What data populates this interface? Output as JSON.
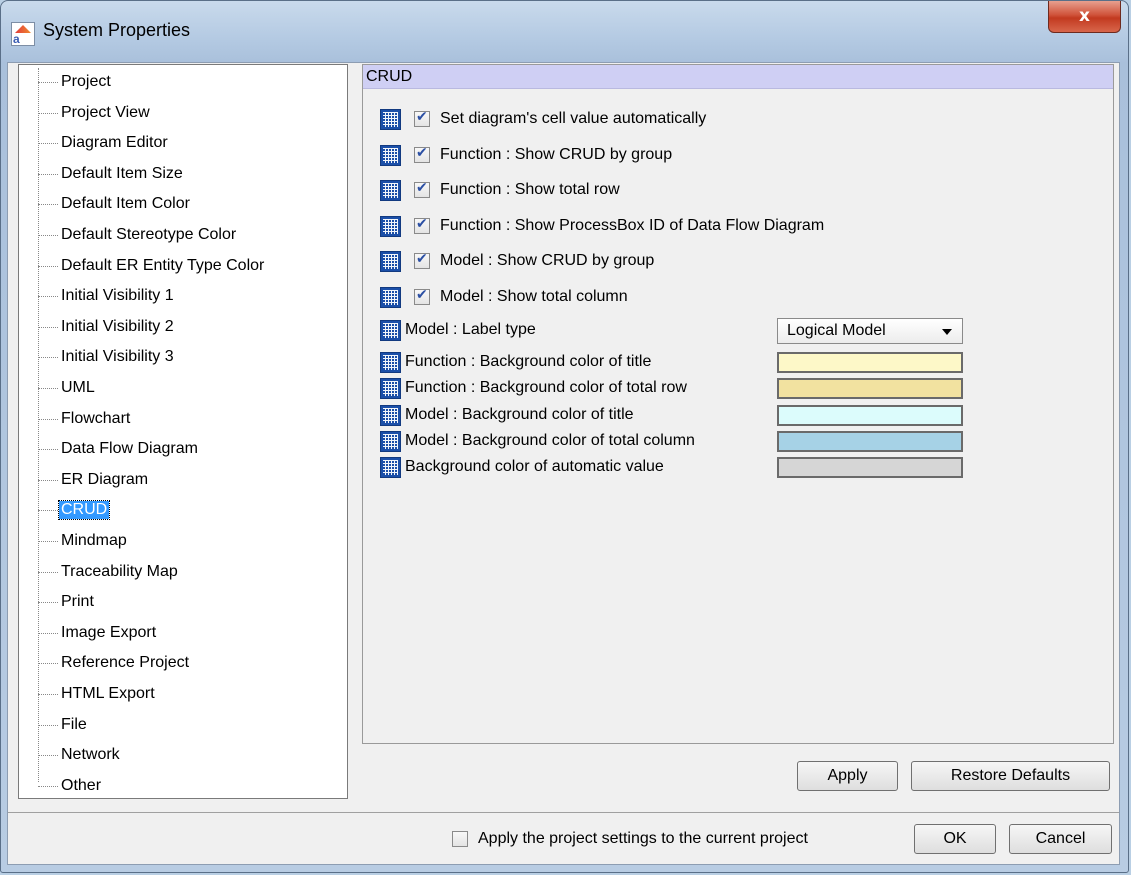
{
  "window": {
    "title": "System Properties",
    "close_glyph": "x"
  },
  "app_icon": {
    "text": "a"
  },
  "tree": {
    "items": [
      {
        "label": "Project"
      },
      {
        "label": "Project View"
      },
      {
        "label": "Diagram Editor"
      },
      {
        "label": "Default Item Size"
      },
      {
        "label": "Default Item Color"
      },
      {
        "label": "Default Stereotype Color"
      },
      {
        "label": "Default ER Entity Type Color"
      },
      {
        "label": "Initial Visibility 1"
      },
      {
        "label": "Initial Visibility 2"
      },
      {
        "label": "Initial Visibility 3"
      },
      {
        "label": "UML"
      },
      {
        "label": "Flowchart"
      },
      {
        "label": "Data Flow Diagram"
      },
      {
        "label": "ER Diagram"
      },
      {
        "label": "CRUD",
        "selected": true
      },
      {
        "label": "Mindmap"
      },
      {
        "label": "Traceability Map"
      },
      {
        "label": "Print"
      },
      {
        "label": "Image Export"
      },
      {
        "label": "Reference Project"
      },
      {
        "label": "HTML Export"
      },
      {
        "label": "File"
      },
      {
        "label": "Network"
      },
      {
        "label": "Other"
      }
    ]
  },
  "panel": {
    "header": "CRUD",
    "checkbox_options": [
      {
        "label": "Set diagram's cell value automatically",
        "checked": true
      },
      {
        "label": "Function : Show CRUD by group",
        "checked": true
      },
      {
        "label": "Function : Show total row",
        "checked": true
      },
      {
        "label": "Function : Show ProcessBox ID of Data Flow Diagram",
        "checked": true
      },
      {
        "label": "Model : Show CRUD by group",
        "checked": true
      },
      {
        "label": "Model : Show total column",
        "checked": true
      }
    ],
    "label_type": {
      "label": "Model : Label type",
      "value": "Logical Model"
    },
    "color_options": [
      {
        "label": "Function : Background color of title",
        "color": "#fdf8c8"
      },
      {
        "label": "Function : Background color of total row",
        "color": "#f2e2a0"
      },
      {
        "label": "Model : Background color of title",
        "color": "#dcfcfc"
      },
      {
        "label": "Model : Background color of total column",
        "color": "#a6d2e6"
      },
      {
        "label": "Background color of automatic value",
        "color": "#d6d6d6"
      }
    ],
    "apply_label": "Apply",
    "restore_label": "Restore Defaults"
  },
  "footer": {
    "apply_project_label": "Apply the project settings to the current project",
    "apply_project_checked": false,
    "ok_label": "OK",
    "cancel_label": "Cancel"
  }
}
